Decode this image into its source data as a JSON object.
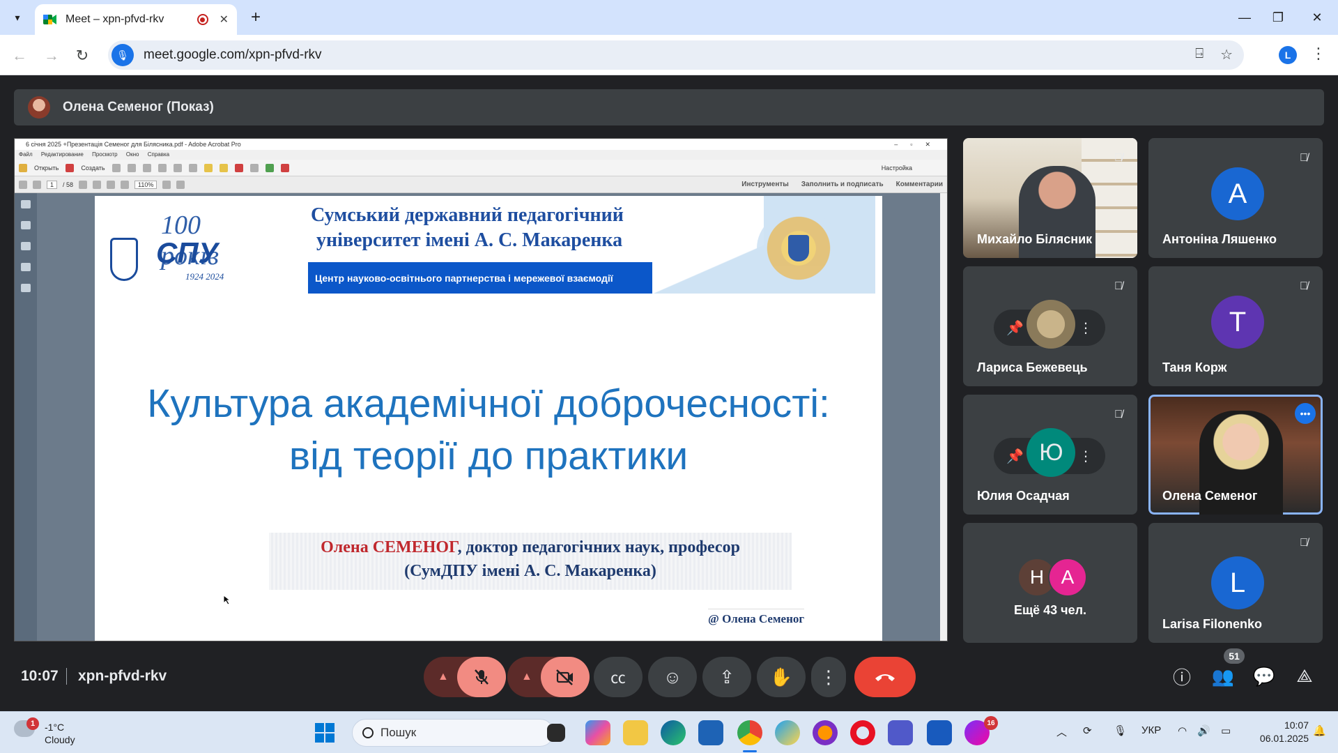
{
  "browser": {
    "tab_title": "Meet – xpn-pfvd-rkv",
    "url": "meet.google.com/xpn-pfvd-rkv",
    "profile_initial": "L"
  },
  "presenter_bar": {
    "label": "Олена Семеног (Показ)"
  },
  "acrobat": {
    "window_title": "6 січня 2025 +Презентація Семеног для Білясника.pdf - Adobe Acrobat Pro",
    "menu": [
      "Файл",
      "Редактирование",
      "Просмотр",
      "Окно",
      "Справка"
    ],
    "open_label": "Открыть",
    "create_label": "Создать",
    "settings_label": "Настройка",
    "page_current": "1",
    "page_total": "/ 58",
    "zoom": "110%",
    "right_tabs": [
      "Инструменты",
      "Заполнить и подписать",
      "Комментарии"
    ]
  },
  "slide": {
    "logo_years": "100 років",
    "logo_acronym": "СПУ",
    "logo_dates": "1924 2024",
    "university_line1": "Сумський державний педагогічний",
    "university_line2": "університет імені А. С. Макаренка",
    "center_strip": "Центр науково-освітнього партнерства і мережевої взаємодії",
    "title_line1": "Культура академічної доброчесності:",
    "title_line2": "від теорії до практики",
    "author_name": "Олена СЕМЕНОГ",
    "author_rest": ", доктор педагогічних наук, професор",
    "author_affil": "(СумДПУ імені А. С. Макаренка)",
    "credit": "@ Олена Семеног"
  },
  "participants": [
    {
      "name": "Михайло Білясник",
      "type": "video",
      "muted": true
    },
    {
      "name": "Антоніна Ляшенко",
      "type": "avatar",
      "initial": "A",
      "color": "#1967d2",
      "muted": true
    },
    {
      "name": "Лариса Бежевець",
      "type": "hover",
      "muted": true
    },
    {
      "name": "Таня Корж",
      "type": "avatar",
      "initial": "T",
      "color": "#5e35b1",
      "muted": true
    },
    {
      "name": "Юлия Осадчая",
      "type": "hover",
      "initial": "Ю",
      "color": "#00897b",
      "muted": true
    },
    {
      "name": "Олена Семеног",
      "type": "video",
      "active": true
    },
    {
      "name": "Ещё 43 чел.",
      "type": "overflow",
      "initials": [
        "Н",
        "А"
      ],
      "colors": [
        "#5d4037",
        "#e52592"
      ]
    },
    {
      "name": "Larisa Filonenko",
      "type": "avatar",
      "initial": "L",
      "color": "#1967d2",
      "muted": true
    }
  ],
  "meeting_bar": {
    "time": "10:07",
    "code": "xpn-pfvd-rkv",
    "participant_count": "51"
  },
  "taskbar": {
    "weather_alert": "1",
    "temperature": "-1°C",
    "condition": "Cloudy",
    "search_placeholder": "Пошук",
    "teams_badge": "16",
    "language": "УКР",
    "clock_time": "10:07",
    "clock_date": "06.01.2025"
  }
}
